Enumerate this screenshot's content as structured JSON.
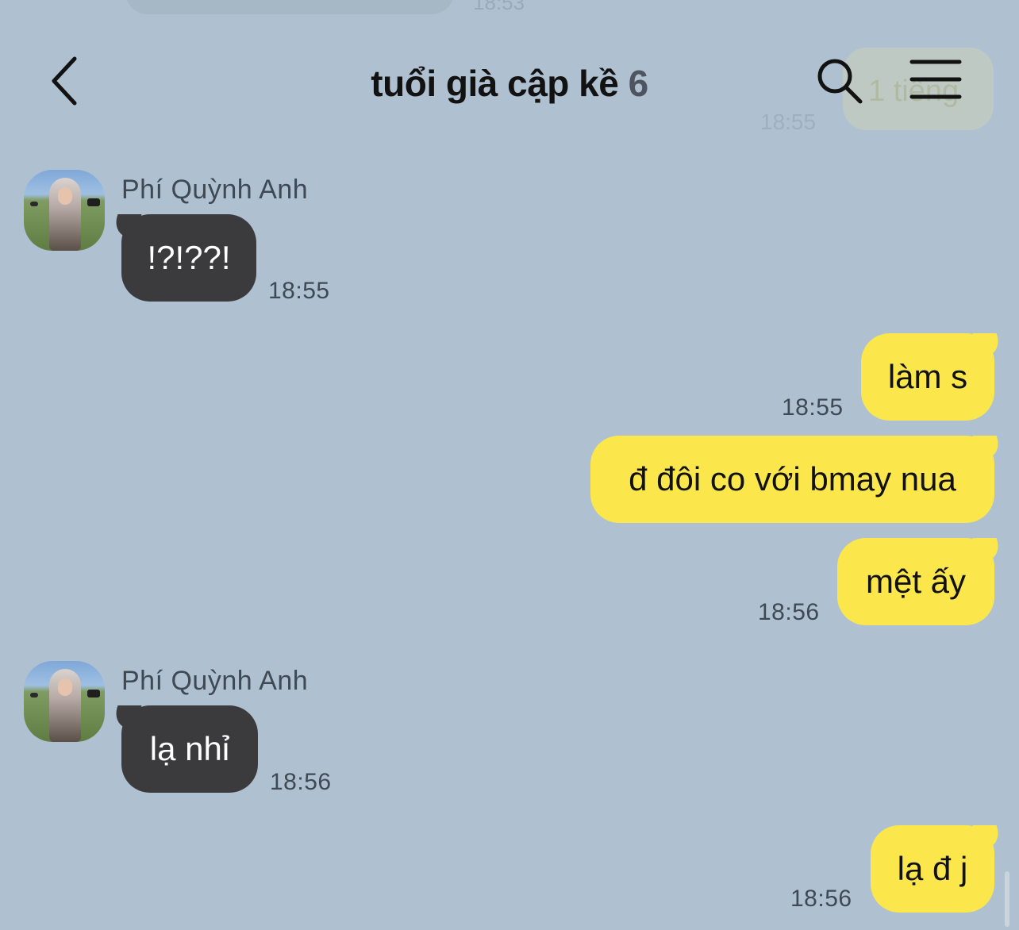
{
  "header": {
    "title": "tuổi già cập kề",
    "member_count": "6"
  },
  "ghost": {
    "top_time": "18:53",
    "right_text": "1 tiếng",
    "right_time": "18:55"
  },
  "messages": [
    {
      "direction": "incoming",
      "sender": "Phí Quỳnh Anh",
      "text": "!?!??!",
      "time": "18:55"
    },
    {
      "direction": "outgoing",
      "text": "làm s",
      "time": "18:55"
    },
    {
      "direction": "outgoing",
      "text": "đ đôi co với bmay nua",
      "time": ""
    },
    {
      "direction": "outgoing",
      "text": "mệt ấy",
      "time": "18:56"
    },
    {
      "direction": "incoming",
      "sender": "Phí Quỳnh Anh",
      "text": "lạ nhỉ",
      "time": "18:56"
    },
    {
      "direction": "outgoing",
      "text": "lạ đ j",
      "time": "18:56"
    }
  ],
  "icons": {
    "back": "chevron-left-icon",
    "search": "search-icon",
    "menu": "hamburger-menu-icon"
  },
  "colors": {
    "background": "#afc1d0",
    "incoming_bubble": "#3b3b3d",
    "outgoing_bubble": "#fbe74c"
  }
}
